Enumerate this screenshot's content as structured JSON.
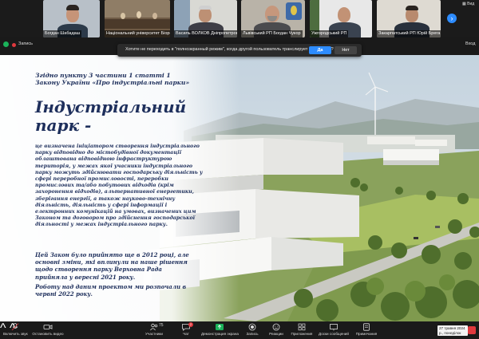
{
  "participants": [
    {
      "name": "Богдан Шабадаш"
    },
    {
      "name": "Національний університет Біорес..."
    },
    {
      "name": "Василь ВОЛКОВ Дніпропетровсь..."
    },
    {
      "name": "Львівський РП Богдан Чукор"
    },
    {
      "name": "Ужгородський РП"
    },
    {
      "name": "Закарпатський РП Юрій Брега"
    }
  ],
  "strip_next_icon": "chevron-right-icon",
  "view_label": "Вид",
  "recording_label": "Запись",
  "exit_label": "Вход",
  "prompt": {
    "text": "Хотите не переходить в \"полноэкранный режим\", когда другой пользователь транслирует свой экран?",
    "yes_label": "Да",
    "no_label": "Нет"
  },
  "slide": {
    "intro": "Згідно пункту 3 частини 1 статті 1 Закону України «Про індустріальні парки»",
    "heading": "Індустріальний парк -",
    "definition": "це визначена ініціатором створення індустріального парку відповідно до містобудівної документації облаштована відповідною інфраструктурою територія, у межах якої учасники індустріального парку можуть здійснювати господарську діяльність у сфері переробної промисловості, переробки промислових та/або побутових відходів (крім захоронення відходів), альтернативної енергетики, зберігання енергії, а також науково-технічну діяльність, діяльність у сфері інформації і електронних комунікацій на умовах, визначених цим Законом та договором про здійснення господарської діяльності у межах індустріального парку.",
    "law_note": "Цей Закон було прийнято ще в 2012 році, але основні зміни, які вплинули на наше рішення щодо створення парку Верховна Рада прийняла у вересні 2021 року.",
    "project_note": "Роботу над даним проектом ми розпочали в червні 2022 року."
  },
  "toolbar": {
    "audio": "Включить звук",
    "video": "Остановить видео",
    "participants": "Участники",
    "participants_count": "75",
    "chat": "Чат",
    "chat_badge": "2",
    "share": "Демонстрация экрана",
    "record": "Запись",
    "reactions": "Реакции",
    "apps": "Приложения",
    "whiteboards": "Доски сообщений",
    "notes": "Примечания"
  },
  "tooltip": "27 травня 2024 р., понеділок",
  "colors": {
    "accent": "#2d8cff",
    "share_green": "#1bb25a",
    "record_red": "#e0393e",
    "slide_text": "#1e2f5c"
  }
}
